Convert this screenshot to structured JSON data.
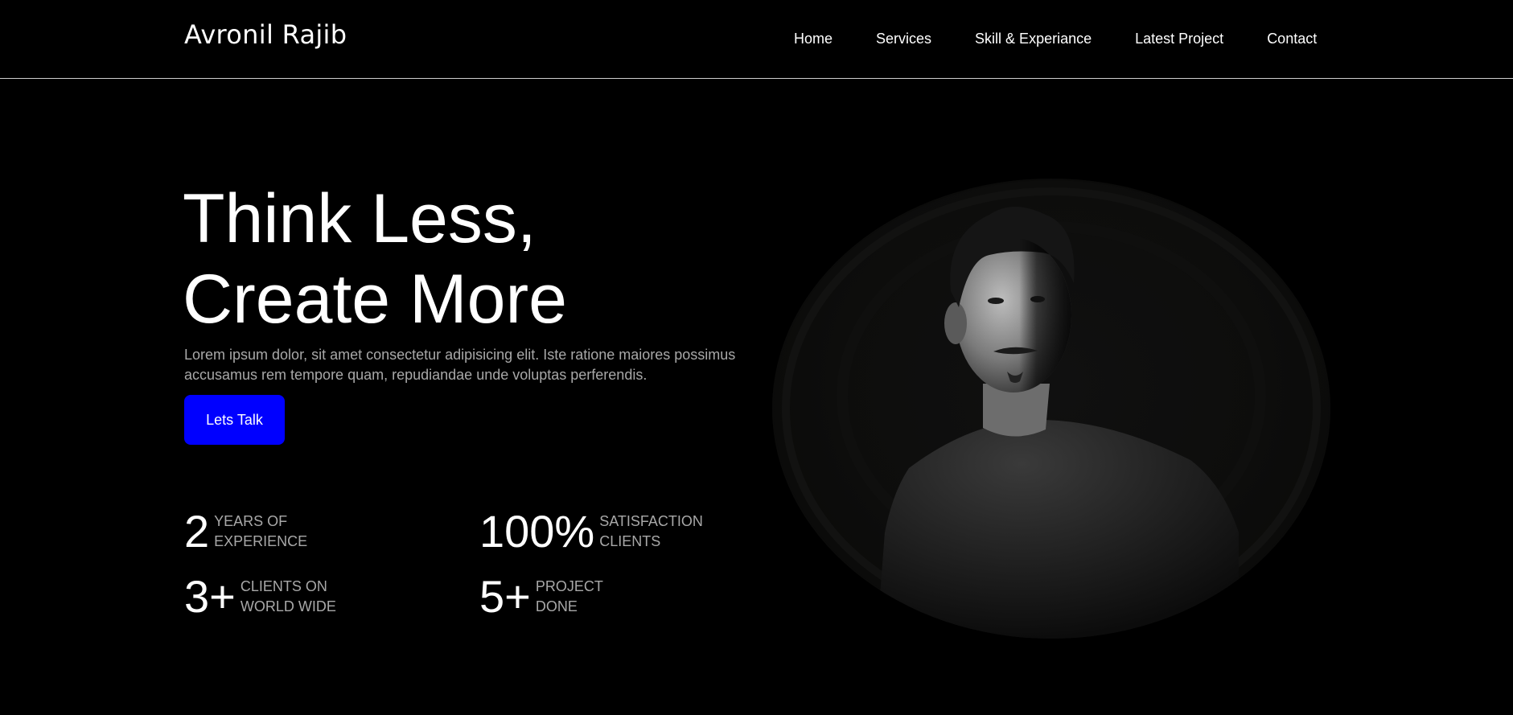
{
  "header": {
    "logo": "Avronil Rajib",
    "nav": [
      "Home",
      "Services",
      "Skill & Experiance",
      "Latest Project",
      "Contact"
    ]
  },
  "hero": {
    "headline_line1": "Think Less,",
    "headline_line2": "Create More",
    "description": "Lorem ipsum dolor, sit amet consectetur adipisicing elit. Iste ratione maiores possimus accusamus rem tempore quam, repudiandae unde voluptas perferendis.",
    "cta_label": "Lets Talk"
  },
  "stats": [
    {
      "number": "2",
      "label": "YEARS OF\nEXPERIENCE"
    },
    {
      "number": "100%",
      "label": "SATISFACTION\nCLIENTS"
    },
    {
      "number": "3+",
      "label": "CLIENTS ON\nWORLD WIDE"
    },
    {
      "number": "5+",
      "label": "PROJECT\nDONE"
    }
  ],
  "colors": {
    "background": "#000000",
    "accent": "#0000ff",
    "muted_text": "#a8a8a8"
  }
}
